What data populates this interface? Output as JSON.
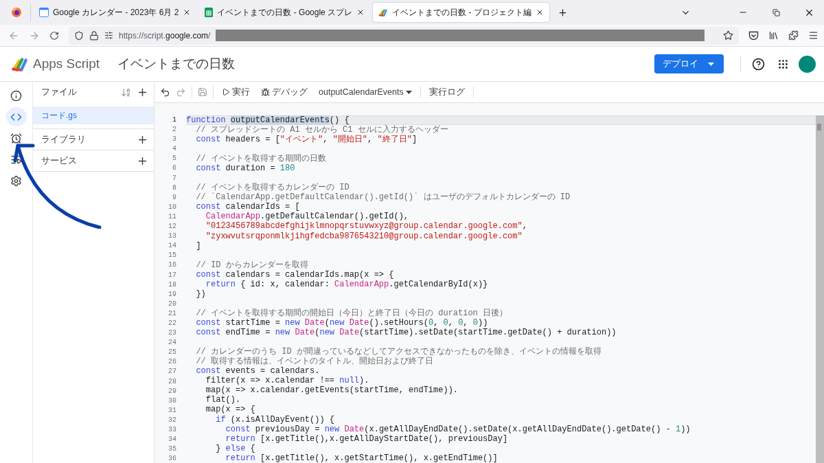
{
  "browser": {
    "tabs": [
      {
        "kind": "calendar",
        "title": "Google カレンダー - 2023年 6月 2",
        "selected": false
      },
      {
        "kind": "sheets",
        "title": "イベントまでの日数 - Google スプレ",
        "selected": false
      },
      {
        "kind": "script",
        "title": "イベントまでの日数 - プロジェクト編",
        "selected": true
      }
    ],
    "address": {
      "url_start": "https://script.",
      "url_host": "google.com",
      "url_rest": "/"
    }
  },
  "header": {
    "product": "Apps Script",
    "project_title": "イベントまでの日数",
    "deploy_button": "デプロイ"
  },
  "rail": [
    {
      "kind": "info",
      "selected": false
    },
    {
      "kind": "code",
      "selected": true
    },
    {
      "kind": "triggers",
      "selected": false
    },
    {
      "kind": "executions",
      "selected": false
    },
    {
      "kind": "settings",
      "selected": false
    }
  ],
  "files_panel": {
    "title": "ファイル",
    "files": [
      {
        "name": "コード.gs",
        "selected": true
      }
    ],
    "sections": [
      "ライブラリ",
      "サービス"
    ]
  },
  "toolbar": {
    "run": "実行",
    "debug": "デバッグ",
    "function_select": "outputCalendarEvents",
    "log": "実行ログ"
  },
  "editor": {
    "lines": [
      {
        "number": "1",
        "current": true,
        "tokens": [
          {
            "kind": "keyword",
            "text": "function "
          },
          {
            "kind": "selected",
            "text": "outputCalendarEvents"
          },
          {
            "kind": "plain",
            "text": "() {"
          }
        ]
      },
      {
        "number": "2",
        "current": false,
        "tokens": [
          {
            "kind": "comment",
            "text": "  // スプレッドシートの A1 セルから C1 セルに入力するヘッダー"
          }
        ]
      },
      {
        "number": "3",
        "current": false,
        "tokens": [
          {
            "kind": "keyword",
            "text": "  const"
          },
          {
            "kind": "plain",
            "text": " headers = ["
          },
          {
            "kind": "string",
            "text": "\"イベント\""
          },
          {
            "kind": "plain",
            "text": ", "
          },
          {
            "kind": "string",
            "text": "\"開始日\""
          },
          {
            "kind": "plain",
            "text": ", "
          },
          {
            "kind": "string",
            "text": "\"終了日\""
          },
          {
            "kind": "plain",
            "text": "]"
          }
        ]
      },
      {
        "number": "4",
        "current": false
      },
      {
        "number": "5",
        "current": false,
        "tokens": [
          {
            "kind": "comment",
            "text": "  // イベントを取得する期間の日数"
          }
        ]
      },
      {
        "number": "6",
        "current": false,
        "tokens": [
          {
            "kind": "keyword",
            "text": "  const"
          },
          {
            "kind": "plain",
            "text": " duration = "
          },
          {
            "kind": "number",
            "text": "180"
          }
        ]
      },
      {
        "number": "7",
        "current": false
      },
      {
        "number": "8",
        "current": false,
        "tokens": [
          {
            "kind": "comment",
            "text": "  // イベントを取得するカレンダーの ID"
          }
        ]
      },
      {
        "number": "9",
        "current": false,
        "tokens": [
          {
            "kind": "comment",
            "text": "  // `CalendarApp.getDefaultCalendar().getId()` はユーザのデフォルトカレンダーの ID"
          }
        ]
      },
      {
        "number": "10",
        "current": false,
        "tokens": [
          {
            "kind": "keyword",
            "text": "  const"
          },
          {
            "kind": "plain",
            "text": " calendarIds = ["
          }
        ]
      },
      {
        "number": "11",
        "current": false,
        "tokens": [
          {
            "kind": "class",
            "text": "    CalendarApp"
          },
          {
            "kind": "plain",
            "text": ".getDefaultCalendar().getId(),"
          }
        ]
      },
      {
        "number": "12",
        "current": false,
        "tokens": [
          {
            "kind": "string",
            "text": "    \"0123456789abcdefghijklmnopqrstuvwxyz@group.calendar.google.com\""
          },
          {
            "kind": "plain",
            "text": ","
          }
        ]
      },
      {
        "number": "13",
        "current": false,
        "tokens": [
          {
            "kind": "string",
            "text": "    \"zyxwvutsrqponmlkjihgfedcba9876543210@group.calendar.google.com\""
          }
        ]
      },
      {
        "number": "14",
        "current": false,
        "tokens": [
          {
            "kind": "plain",
            "text": "  ]"
          }
        ]
      },
      {
        "number": "15",
        "current": false
      },
      {
        "number": "16",
        "current": false,
        "tokens": [
          {
            "kind": "comment",
            "text": "  // ID からカレンダーを取得"
          }
        ]
      },
      {
        "number": "17",
        "current": false,
        "tokens": [
          {
            "kind": "keyword",
            "text": "  const"
          },
          {
            "kind": "plain",
            "text": " calendars = calendarIds.map(x => {"
          }
        ]
      },
      {
        "number": "18",
        "current": false,
        "tokens": [
          {
            "kind": "keyword",
            "text": "    return"
          },
          {
            "kind": "plain",
            "text": " { id: x, calendar: "
          },
          {
            "kind": "class",
            "text": "CalendarApp"
          },
          {
            "kind": "plain",
            "text": ".getCalendarById(x)}"
          }
        ]
      },
      {
        "number": "19",
        "current": false,
        "tokens": [
          {
            "kind": "plain",
            "text": "  })"
          }
        ]
      },
      {
        "number": "20",
        "current": false
      },
      {
        "number": "21",
        "current": false,
        "tokens": [
          {
            "kind": "comment",
            "text": "  // イベントを取得する期間の開始日（今日）と終了日（今日の duration 日後）"
          }
        ]
      },
      {
        "number": "22",
        "current": false,
        "tokens": [
          {
            "kind": "keyword",
            "text": "  const"
          },
          {
            "kind": "plain",
            "text": " startTime = "
          },
          {
            "kind": "keyword",
            "text": "new "
          },
          {
            "kind": "class",
            "text": "Date"
          },
          {
            "kind": "plain",
            "text": "("
          },
          {
            "kind": "keyword",
            "text": "new "
          },
          {
            "kind": "class",
            "text": "Date"
          },
          {
            "kind": "plain",
            "text": "().setHours("
          },
          {
            "kind": "number",
            "text": "0"
          },
          {
            "kind": "plain",
            "text": ", "
          },
          {
            "kind": "number",
            "text": "0"
          },
          {
            "kind": "plain",
            "text": ", "
          },
          {
            "kind": "number",
            "text": "0"
          },
          {
            "kind": "plain",
            "text": ", "
          },
          {
            "kind": "number",
            "text": "0"
          },
          {
            "kind": "plain",
            "text": "))"
          }
        ]
      },
      {
        "number": "23",
        "current": false,
        "tokens": [
          {
            "kind": "keyword",
            "text": "  const"
          },
          {
            "kind": "plain",
            "text": " endTime = "
          },
          {
            "kind": "keyword",
            "text": "new "
          },
          {
            "kind": "class",
            "text": "Date"
          },
          {
            "kind": "plain",
            "text": "("
          },
          {
            "kind": "keyword",
            "text": "new "
          },
          {
            "kind": "class",
            "text": "Date"
          },
          {
            "kind": "plain",
            "text": "(startTime).setDate(startTime.getDate() + duration))"
          }
        ]
      },
      {
        "number": "24",
        "current": false
      },
      {
        "number": "25",
        "current": false,
        "tokens": [
          {
            "kind": "comment",
            "text": "  // カレンダーのうち ID が間違っているなどしてアクセスできなかったものを除き、イベントの情報を取得"
          }
        ]
      },
      {
        "number": "26",
        "current": false,
        "tokens": [
          {
            "kind": "comment",
            "text": "  // 取得する情報は、イベントのタイトル、開始日および終了日"
          }
        ]
      },
      {
        "number": "27",
        "current": false,
        "tokens": [
          {
            "kind": "keyword",
            "text": "  const"
          },
          {
            "kind": "plain",
            "text": " events = calendars."
          }
        ]
      },
      {
        "number": "28",
        "current": false,
        "tokens": [
          {
            "kind": "plain",
            "text": "    filter(x => x.calendar !== "
          },
          {
            "kind": "keyword",
            "text": "null"
          },
          {
            "kind": "plain",
            "text": ")."
          }
        ]
      },
      {
        "number": "29",
        "current": false,
        "tokens": [
          {
            "kind": "plain",
            "text": "    map(x => x.calendar.getEvents(startTime, endTime))."
          }
        ]
      },
      {
        "number": "30",
        "current": false,
        "tokens": [
          {
            "kind": "plain",
            "text": "    flat()."
          }
        ]
      },
      {
        "number": "31",
        "current": false,
        "tokens": [
          {
            "kind": "plain",
            "text": "    map(x => {"
          }
        ]
      },
      {
        "number": "32",
        "current": false,
        "tokens": [
          {
            "kind": "keyword",
            "text": "      if"
          },
          {
            "kind": "plain",
            "text": " (x.isAllDayEvent()) {"
          }
        ]
      },
      {
        "number": "33",
        "current": false,
        "tokens": [
          {
            "kind": "keyword",
            "text": "        const"
          },
          {
            "kind": "plain",
            "text": " previousDay = "
          },
          {
            "kind": "keyword",
            "text": "new "
          },
          {
            "kind": "class",
            "text": "Date"
          },
          {
            "kind": "plain",
            "text": "(x.getAllDayEndDate().setDate(x.getAllDayEndDate().getDate() - "
          },
          {
            "kind": "number",
            "text": "1"
          },
          {
            "kind": "plain",
            "text": "))"
          }
        ]
      },
      {
        "number": "34",
        "current": false,
        "tokens": [
          {
            "kind": "keyword",
            "text": "        return"
          },
          {
            "kind": "plain",
            "text": " [x.getTitle(),x.getAllDayStartDate(), previousDay]"
          }
        ]
      },
      {
        "number": "35",
        "current": false,
        "tokens": [
          {
            "kind": "plain",
            "text": "      } "
          },
          {
            "kind": "keyword",
            "text": "else"
          },
          {
            "kind": "plain",
            "text": " {"
          }
        ]
      },
      {
        "number": "36",
        "current": false,
        "tokens": [
          {
            "kind": "keyword",
            "text": "        return"
          },
          {
            "kind": "plain",
            "text": " [x.getTitle(), x.getStartTime(), x.getEndTime()]"
          }
        ]
      }
    ]
  }
}
